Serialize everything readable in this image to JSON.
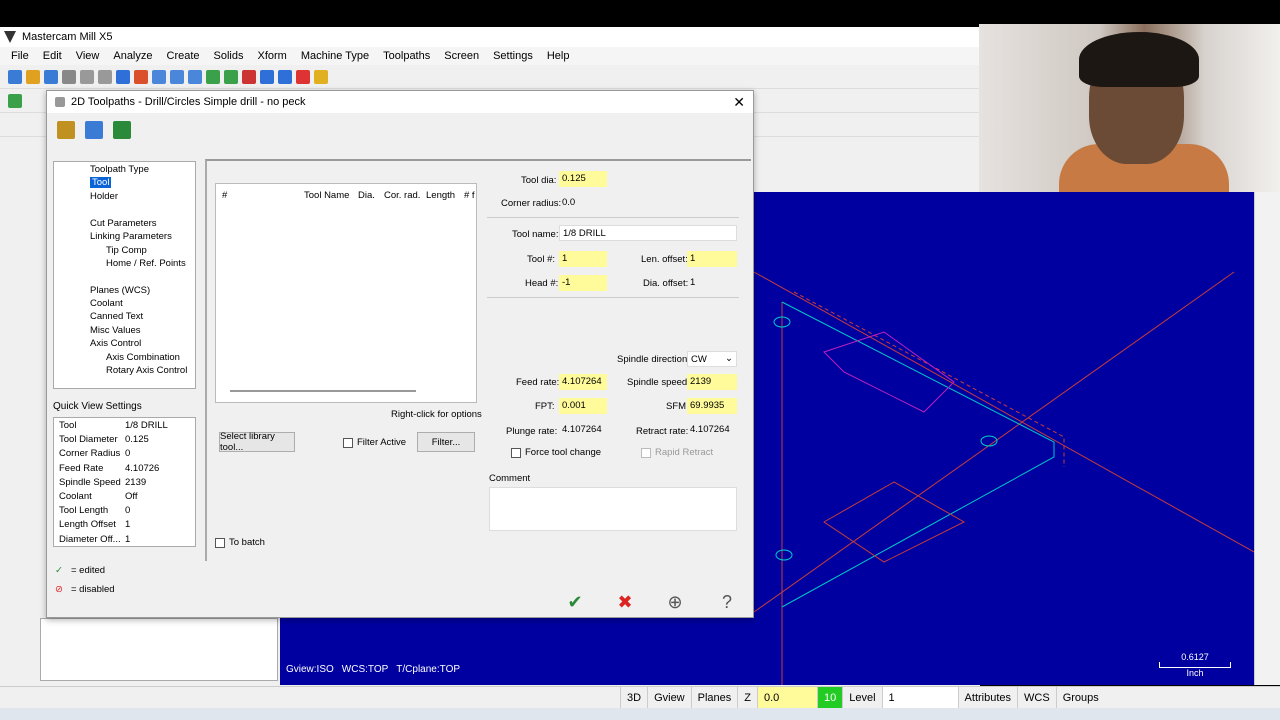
{
  "app": {
    "title": "Mastercam Mill X5"
  },
  "menu": [
    "File",
    "Edit",
    "View",
    "Analyze",
    "Create",
    "Solids",
    "Xform",
    "Machine Type",
    "Toolpaths",
    "Screen",
    "Settings",
    "Help"
  ],
  "dialog": {
    "title": "2D Toolpaths - Drill/Circles Simple drill - no peck",
    "tree": [
      {
        "label": "Toolpath Type",
        "indent": 0
      },
      {
        "label": "Tool",
        "indent": 0,
        "selected": true
      },
      {
        "label": "Holder",
        "indent": 0
      },
      {
        "label": "Cut Parameters",
        "indent": 0
      },
      {
        "label": "Linking Parameters",
        "indent": 0
      },
      {
        "label": "Tip Comp",
        "indent": 1
      },
      {
        "label": "Home / Ref. Points",
        "indent": 1
      },
      {
        "label": "Planes (WCS)",
        "indent": 0
      },
      {
        "label": "Coolant",
        "indent": 0
      },
      {
        "label": "Canned Text",
        "indent": 0
      },
      {
        "label": "Misc Values",
        "indent": 0
      },
      {
        "label": "Axis Control",
        "indent": 0
      },
      {
        "label": "Axis Combination",
        "indent": 1
      },
      {
        "label": "Rotary Axis Control",
        "indent": 1
      }
    ],
    "quick_view_title": "Quick View Settings",
    "quick_view": [
      {
        "k": "Tool",
        "v": "1/8 DRILL"
      },
      {
        "k": "Tool Diameter",
        "v": "0.125"
      },
      {
        "k": "Corner Radius",
        "v": "0"
      },
      {
        "k": "Feed Rate",
        "v": "4.10726"
      },
      {
        "k": "Spindle Speed",
        "v": "2139"
      },
      {
        "k": "Coolant",
        "v": "Off"
      },
      {
        "k": "Tool Length",
        "v": "0"
      },
      {
        "k": "Length Offset",
        "v": "1"
      },
      {
        "k": "Diameter Off...",
        "v": "1"
      }
    ],
    "legend_edited": "= edited",
    "legend_disabled": "= disabled",
    "tool_list_headers": [
      "#",
      "Tool Name",
      "Dia.",
      "Cor. rad.",
      "Length",
      "# f"
    ],
    "right_click_hint": "Right-click for options",
    "select_library_tool": "Select library tool...",
    "filter_active": "Filter Active",
    "filter": "Filter...",
    "to_batch": "To batch",
    "fields": {
      "tool_dia_label": "Tool dia:",
      "tool_dia": "0.125",
      "corner_radius_label": "Corner radius:",
      "corner_radius": "0.0",
      "tool_name_label": "Tool name:",
      "tool_name": "1/8 DRILL",
      "tool_num_label": "Tool #:",
      "tool_num": "1",
      "len_offset_label": "Len. offset:",
      "len_offset": "1",
      "head_num_label": "Head #:",
      "head_num": "-1",
      "dia_offset_label": "Dia. offset:",
      "dia_offset": "1",
      "spindle_dir_label": "Spindle direction:",
      "spindle_dir": "CW",
      "feed_rate_label": "Feed rate:",
      "feed_rate": "4.107264",
      "spindle_speed_label": "Spindle speed:",
      "spindle_speed": "2139",
      "fpt_label": "FPT:",
      "fpt": "0.001",
      "sfm_label": "SFM",
      "sfm": "69.9935",
      "plunge_rate_label": "Plunge rate:",
      "plunge_rate": "4.107264",
      "retract_rate_label": "Retract rate:",
      "retract_rate": "4.107264",
      "force_tool_change": "Force tool change",
      "rapid_retract": "Rapid Retract",
      "comment_label": "Comment"
    }
  },
  "viewport": {
    "status": [
      "Gview:ISO",
      "WCS:TOP",
      "T/Cplane:TOP"
    ],
    "scale_value": "0.6127",
    "scale_unit": "Inch"
  },
  "bottombar": {
    "items": [
      "3D",
      "Gview",
      "Planes",
      "Z",
      "0.0",
      "10",
      "Level",
      "1",
      "Attributes",
      "WCS",
      "Groups"
    ]
  },
  "colors": {
    "viewport_bg": "#0000a0",
    "field_yellow": "#fffb9a",
    "selection": "#0a64d8"
  }
}
